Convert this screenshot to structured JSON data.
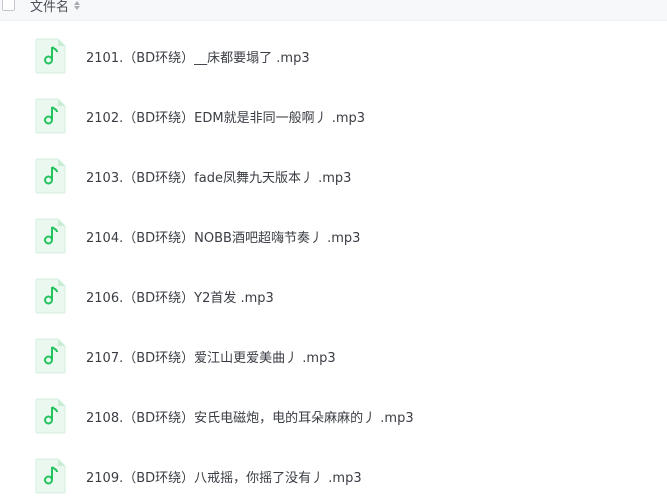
{
  "header": {
    "column_label": "文件名"
  },
  "files": [
    {
      "name": "2101.（BD环绕）__床都要塌了 .mp3",
      "icon": "music-file-icon"
    },
    {
      "name": "2102.（BD环绕）EDM就是非同一般啊丿 .mp3",
      "icon": "music-file-icon"
    },
    {
      "name": "2103.（BD环绕）fade凤舞九天版本丿 .mp3",
      "icon": "music-file-icon"
    },
    {
      "name": "2104.（BD环绕）NOBB酒吧超嗨节奏丿 .mp3",
      "icon": "music-file-icon"
    },
    {
      "name": "2106.（BD环绕）Y2首发 .mp3",
      "icon": "music-file-icon"
    },
    {
      "name": "2107.（BD环绕）爱江山更爱美曲丿 .mp3",
      "icon": "music-file-icon"
    },
    {
      "name": "2108.（BD环绕）安氏电磁炮，电的耳朵麻麻的丿 .mp3",
      "icon": "music-file-icon"
    },
    {
      "name": "2109.（BD环绕）八戒摇，你摇了没有丿 .mp3",
      "icon": "music-file-icon"
    }
  ],
  "colors": {
    "accent": "#23c35d",
    "icon_bg": "#eaf8ef",
    "text": "#3a3d44"
  }
}
